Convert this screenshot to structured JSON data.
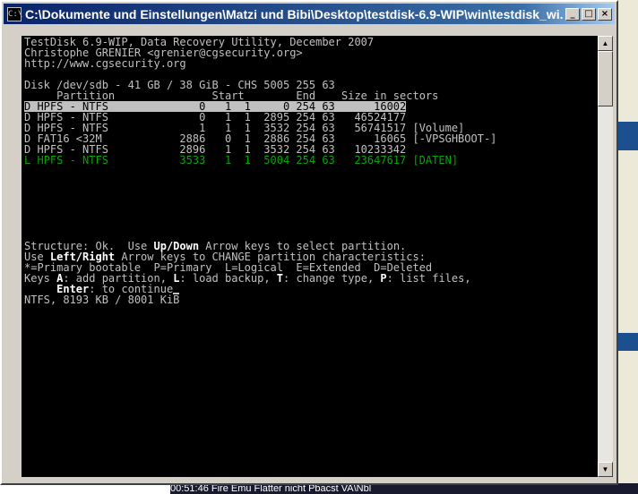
{
  "window": {
    "title": "C:\\Dokumente und Einstellungen\\Matzi und Bibi\\Desktop\\testdisk-6.9-WIP\\win\\testdisk_wi...",
    "icon": "console-icon",
    "minimize_label": "_",
    "maximize_label": "□",
    "close_label": "×"
  },
  "console": {
    "header_lines": [
      "TestDisk 6.9-WIP, Data Recovery Utility, December 2007",
      "Christophe GRENIER <grenier@cgsecurity.org>",
      "http://www.cgsecurity.org"
    ],
    "disk_line": "Disk /dev/sdb - 41 GB / 38 GiB - CHS 5005 255 63",
    "columns_line": "     Partition               Start        End    Size in sectors",
    "partitions": [
      "D HPFS - NTFS              0   1  1     0 254 63      16002",
      "D HPFS - NTFS              0   1  1  2895 254 63   46524177",
      "D HPFS - NTFS              1   1  1  3532 254 63   56741517 [Volume]",
      "D FAT16 <32M            2886   0  1  2886 254 63      16065 [-VPSGHBOOT-]",
      "D HPFS - NTFS           2896   1  1  3532 254 63   10233342",
      "L HPFS - NTFS           3533   1  1  5004 254 63   23647617 [DATEN]"
    ],
    "status_1_a": "Structure: Ok.  Use ",
    "status_1_b": "Up/Down",
    "status_1_c": " Arrow keys to select partition.",
    "status_2_a": "Use ",
    "status_2_b": "Left/Right",
    "status_2_c": " Arrow keys to CHANGE partition characteristics:",
    "legend": "*=Primary bootable  P=Primary  L=Logical  E=Extended  D=Deleted",
    "keys_a": "Keys ",
    "keys_b": "A",
    "keys_c": ": add partition, ",
    "keys_d": "L",
    "keys_e": ": load backup, ",
    "keys_f": "T",
    "keys_g": ": change type, ",
    "keys_h": "P",
    "keys_i": ": list files,",
    "enter_a": "     ",
    "enter_b": "Enter",
    "enter_c": ": to continue",
    "info_line": "NTFS, 8193 KB / 8001 KiB"
  },
  "scrollbar": {
    "up_arrow": "▲",
    "down_arrow": "▼"
  },
  "taskbar": {
    "text": "00:51:46           Fire Emu   Flatter   nicht Pbacst  VA\\Nbl"
  },
  "colors": {
    "console_bg": "#000000",
    "console_text": "#c0c0c0",
    "selected_bg": "#c0c0c0",
    "logical_green": "#00a800",
    "titlebar_start": "#0a246a",
    "titlebar_end": "#a6caf0"
  }
}
